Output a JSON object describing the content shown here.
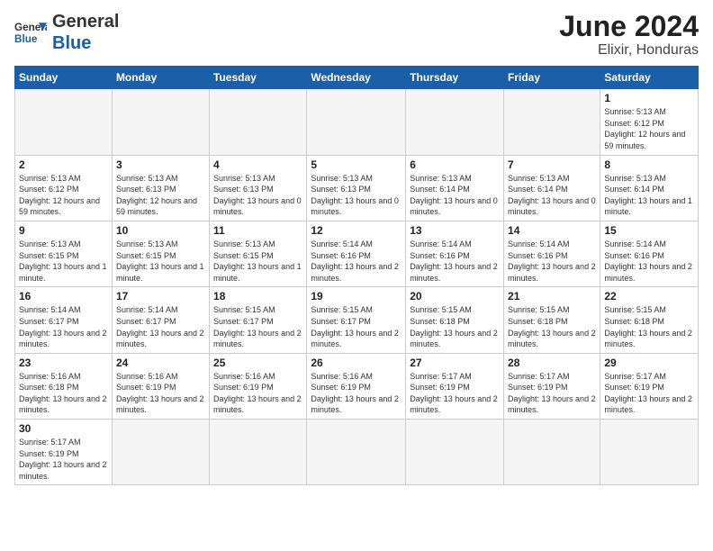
{
  "logo": {
    "text_general": "General",
    "text_blue": "Blue"
  },
  "title": "June 2024",
  "location": "Elixir, Honduras",
  "days_of_week": [
    "Sunday",
    "Monday",
    "Tuesday",
    "Wednesday",
    "Thursday",
    "Friday",
    "Saturday"
  ],
  "weeks": [
    [
      {
        "day": "",
        "info": ""
      },
      {
        "day": "",
        "info": ""
      },
      {
        "day": "",
        "info": ""
      },
      {
        "day": "",
        "info": ""
      },
      {
        "day": "",
        "info": ""
      },
      {
        "day": "",
        "info": ""
      },
      {
        "day": "1",
        "info": "Sunrise: 5:13 AM\nSunset: 6:12 PM\nDaylight: 12 hours and 59 minutes."
      }
    ],
    [
      {
        "day": "2",
        "info": "Sunrise: 5:13 AM\nSunset: 6:12 PM\nDaylight: 12 hours and 59 minutes."
      },
      {
        "day": "3",
        "info": "Sunrise: 5:13 AM\nSunset: 6:13 PM\nDaylight: 12 hours and 59 minutes."
      },
      {
        "day": "4",
        "info": "Sunrise: 5:13 AM\nSunset: 6:13 PM\nDaylight: 13 hours and 0 minutes."
      },
      {
        "day": "5",
        "info": "Sunrise: 5:13 AM\nSunset: 6:13 PM\nDaylight: 13 hours and 0 minutes."
      },
      {
        "day": "6",
        "info": "Sunrise: 5:13 AM\nSunset: 6:14 PM\nDaylight: 13 hours and 0 minutes."
      },
      {
        "day": "7",
        "info": "Sunrise: 5:13 AM\nSunset: 6:14 PM\nDaylight: 13 hours and 0 minutes."
      },
      {
        "day": "8",
        "info": "Sunrise: 5:13 AM\nSunset: 6:14 PM\nDaylight: 13 hours and 1 minute."
      }
    ],
    [
      {
        "day": "9",
        "info": "Sunrise: 5:13 AM\nSunset: 6:15 PM\nDaylight: 13 hours and 1 minute."
      },
      {
        "day": "10",
        "info": "Sunrise: 5:13 AM\nSunset: 6:15 PM\nDaylight: 13 hours and 1 minute."
      },
      {
        "day": "11",
        "info": "Sunrise: 5:13 AM\nSunset: 6:15 PM\nDaylight: 13 hours and 1 minute."
      },
      {
        "day": "12",
        "info": "Sunrise: 5:14 AM\nSunset: 6:16 PM\nDaylight: 13 hours and 2 minutes."
      },
      {
        "day": "13",
        "info": "Sunrise: 5:14 AM\nSunset: 6:16 PM\nDaylight: 13 hours and 2 minutes."
      },
      {
        "day": "14",
        "info": "Sunrise: 5:14 AM\nSunset: 6:16 PM\nDaylight: 13 hours and 2 minutes."
      },
      {
        "day": "15",
        "info": "Sunrise: 5:14 AM\nSunset: 6:16 PM\nDaylight: 13 hours and 2 minutes."
      }
    ],
    [
      {
        "day": "16",
        "info": "Sunrise: 5:14 AM\nSunset: 6:17 PM\nDaylight: 13 hours and 2 minutes."
      },
      {
        "day": "17",
        "info": "Sunrise: 5:14 AM\nSunset: 6:17 PM\nDaylight: 13 hours and 2 minutes."
      },
      {
        "day": "18",
        "info": "Sunrise: 5:15 AM\nSunset: 6:17 PM\nDaylight: 13 hours and 2 minutes."
      },
      {
        "day": "19",
        "info": "Sunrise: 5:15 AM\nSunset: 6:17 PM\nDaylight: 13 hours and 2 minutes."
      },
      {
        "day": "20",
        "info": "Sunrise: 5:15 AM\nSunset: 6:18 PM\nDaylight: 13 hours and 2 minutes."
      },
      {
        "day": "21",
        "info": "Sunrise: 5:15 AM\nSunset: 6:18 PM\nDaylight: 13 hours and 2 minutes."
      },
      {
        "day": "22",
        "info": "Sunrise: 5:15 AM\nSunset: 6:18 PM\nDaylight: 13 hours and 2 minutes."
      }
    ],
    [
      {
        "day": "23",
        "info": "Sunrise: 5:16 AM\nSunset: 6:18 PM\nDaylight: 13 hours and 2 minutes."
      },
      {
        "day": "24",
        "info": "Sunrise: 5:16 AM\nSunset: 6:19 PM\nDaylight: 13 hours and 2 minutes."
      },
      {
        "day": "25",
        "info": "Sunrise: 5:16 AM\nSunset: 6:19 PM\nDaylight: 13 hours and 2 minutes."
      },
      {
        "day": "26",
        "info": "Sunrise: 5:16 AM\nSunset: 6:19 PM\nDaylight: 13 hours and 2 minutes."
      },
      {
        "day": "27",
        "info": "Sunrise: 5:17 AM\nSunset: 6:19 PM\nDaylight: 13 hours and 2 minutes."
      },
      {
        "day": "28",
        "info": "Sunrise: 5:17 AM\nSunset: 6:19 PM\nDaylight: 13 hours and 2 minutes."
      },
      {
        "day": "29",
        "info": "Sunrise: 5:17 AM\nSunset: 6:19 PM\nDaylight: 13 hours and 2 minutes."
      }
    ],
    [
      {
        "day": "30",
        "info": "Sunrise: 5:17 AM\nSunset: 6:19 PM\nDaylight: 13 hours and 2 minutes."
      },
      {
        "day": "",
        "info": ""
      },
      {
        "day": "",
        "info": ""
      },
      {
        "day": "",
        "info": ""
      },
      {
        "day": "",
        "info": ""
      },
      {
        "day": "",
        "info": ""
      },
      {
        "day": "",
        "info": ""
      }
    ]
  ]
}
